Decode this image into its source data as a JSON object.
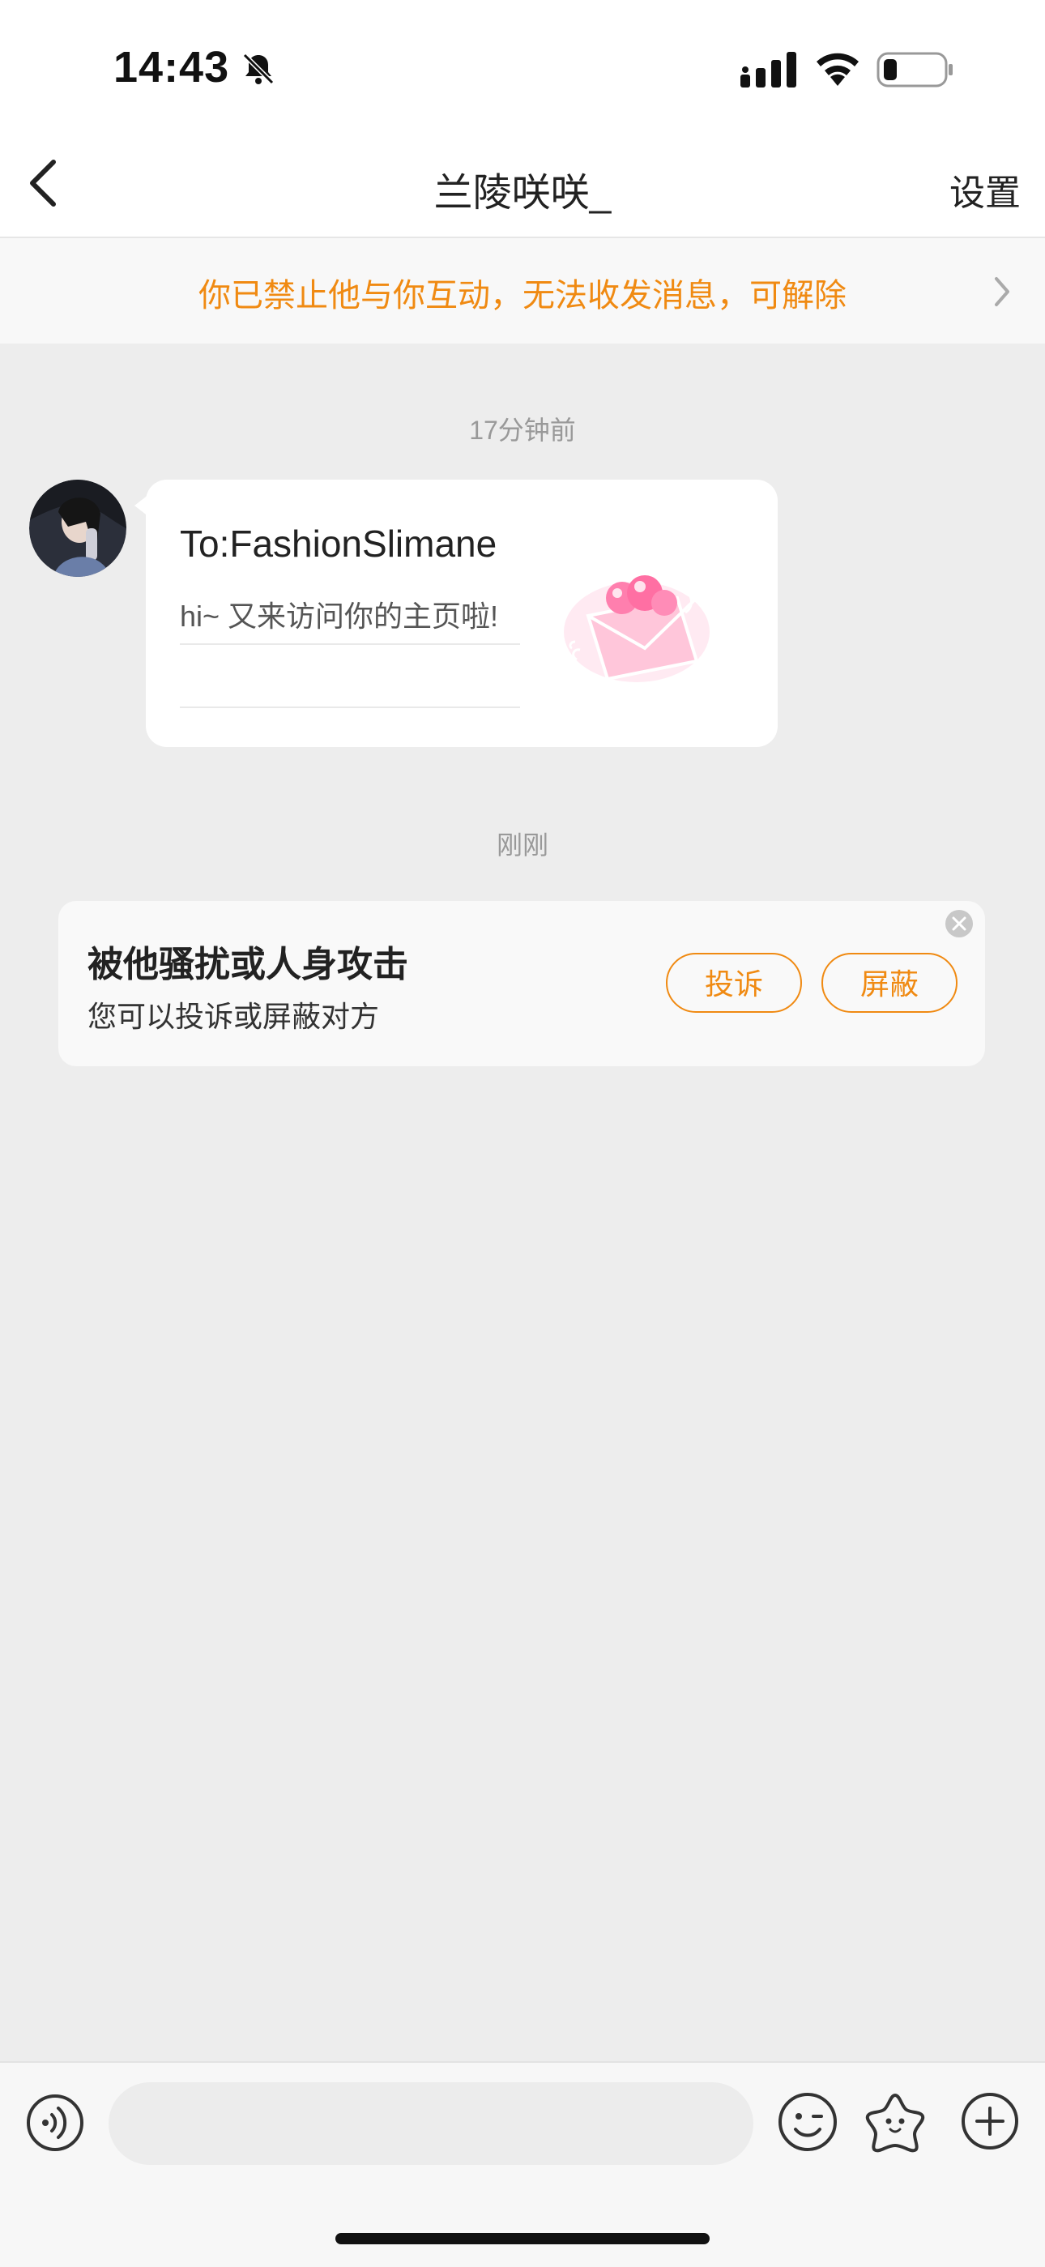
{
  "status_bar": {
    "time": "14:43",
    "icons": [
      "bell-slash-icon",
      "cellular-signal-icon",
      "wifi-icon",
      "battery-icon"
    ]
  },
  "nav": {
    "title": "兰陵咲咲_",
    "settings_label": "设置",
    "back_icon": "chevron-left-icon"
  },
  "banner": {
    "text": "你已禁止他与你互动，无法收发消息，可解除",
    "icon": "chevron-right-icon",
    "color": "#f08a12"
  },
  "messages": [
    {
      "timestamp": "17分钟前",
      "type": "visit-card",
      "card_to": "To:FashionSlimane",
      "card_text": "hi~ 又来访问你的主页啦!",
      "image": "pink-envelope-hearts-icon"
    }
  ],
  "timestamp_2": "刚刚",
  "harassment_prompt": {
    "title": "被他骚扰或人身攻击",
    "subtitle": "您可以投诉或屏蔽对方",
    "complain_label": "投诉",
    "block_label": "屏蔽",
    "close_icon": "close-circle-icon"
  },
  "input_bar": {
    "placeholder": "",
    "icons": [
      "voice-icon",
      "emoji-icon",
      "sticker-star-icon",
      "plus-icon"
    ]
  },
  "colors": {
    "accent": "#f08a12",
    "background": "#ededed"
  }
}
